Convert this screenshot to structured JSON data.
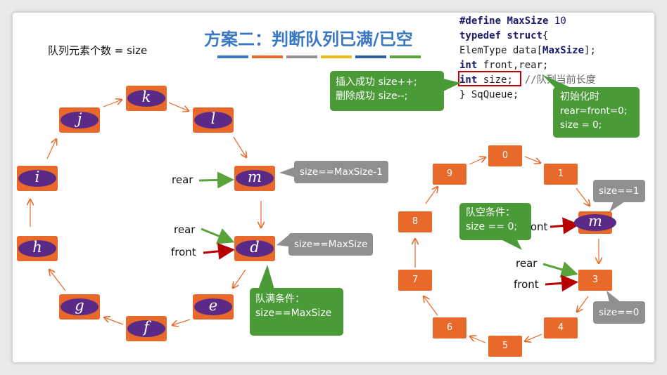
{
  "title": "方案二：判断队列已满/已空",
  "title_bar_colors": [
    "#3b78c4",
    "#e8692a",
    "#8f8f8f",
    "#f1b81c",
    "#2f5fa8",
    "#5aa33a"
  ],
  "subtitle": "队列元素个数 = size",
  "code": {
    "line1_kw": "#define",
    "line1_macro": "MaxSize",
    "line1_num": "10",
    "line2_kw": "typedef struct",
    "line2_rest": "{",
    "line3_type": "ElemType data[",
    "line3_macro": "MaxSize",
    "line3_rest": "];",
    "line4_kw": "int",
    "line4_rest": " front,rear;",
    "line5_kw": "int",
    "line5_rest": " size;",
    "line5_comment": "  //队列当前长度",
    "line6": "} SqQueue;"
  },
  "left_ring": {
    "nodes": [
      "k",
      "l",
      "m",
      "d",
      "e",
      "f",
      "g",
      "h",
      "i",
      "j"
    ],
    "rear_label_1": "rear",
    "rear_label_2": "rear",
    "front_label": "front",
    "callout_m": "size==MaxSize-1",
    "callout_d": "size==MaxSize",
    "full_title": "队满条件：",
    "full_text": "size==MaxSize"
  },
  "insert_box": {
    "line1": "插入成功 size++;",
    "line2": "删除成功 size--;"
  },
  "init_box": {
    "line1": "初始化时",
    "line2": "rear=front=0;",
    "line3": "size = 0;"
  },
  "right_ring": {
    "nodes": [
      "0",
      "1",
      "m",
      "3",
      "4",
      "5",
      "6",
      "7",
      "8",
      "9"
    ],
    "empty_title": "队空条件：",
    "empty_text": "size == 0;",
    "front_label_partial": "ront",
    "rear_label": "rear",
    "front_label": "front",
    "callout_1": "size==1",
    "callout_0": "size==0"
  },
  "colors": {
    "node": "#e8692a",
    "ellipse": "#5b2a86",
    "green": "#4a9a38",
    "gray": "#8f8f8f",
    "arrow_green": "#5aa33a",
    "arrow_red": "#b80000",
    "highlight": "#c00000"
  }
}
